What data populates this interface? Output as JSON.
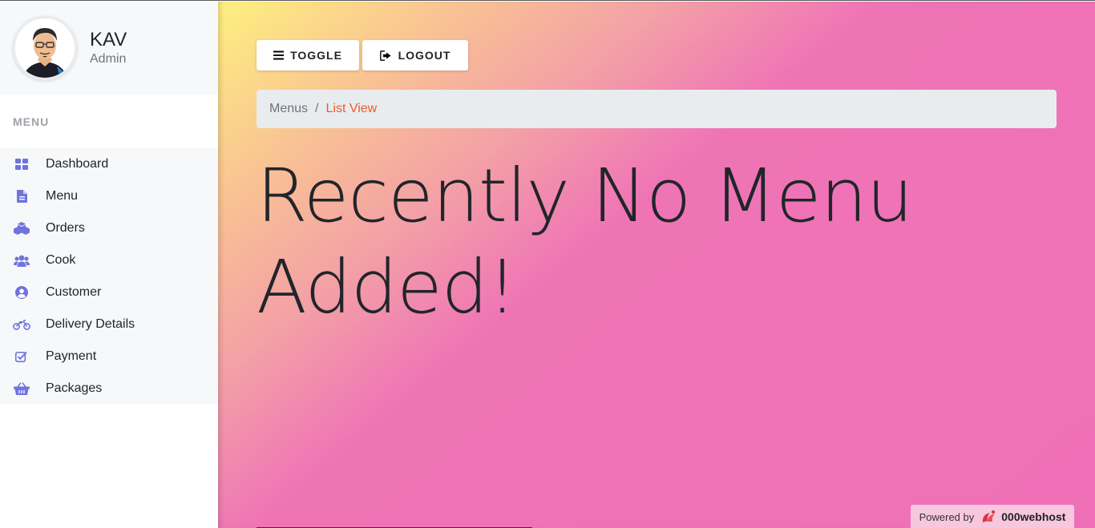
{
  "profile": {
    "name": "KAV",
    "role": "Admin"
  },
  "sidebar": {
    "heading": "MENU",
    "items": [
      {
        "label": "Dashboard",
        "icon": "dashboard-grid-icon"
      },
      {
        "label": "Menu",
        "icon": "document-icon"
      },
      {
        "label": "Orders",
        "icon": "cubes-icon"
      },
      {
        "label": "Cook",
        "icon": "users-icon"
      },
      {
        "label": "Customer",
        "icon": "user-circle-icon"
      },
      {
        "label": "Delivery Details",
        "icon": "motorcycle-icon"
      },
      {
        "label": "Payment",
        "icon": "check-square-icon"
      },
      {
        "label": "Packages",
        "icon": "basket-icon"
      }
    ],
    "icon_color": "#6f74dd"
  },
  "toolbar": {
    "toggle_label": "TOGGLE",
    "logout_label": "LOGOUT"
  },
  "breadcrumb": {
    "parent": "Menus",
    "separator": "/",
    "current": "List View"
  },
  "main": {
    "heading_line1": "Recently No Menu",
    "heading_line2": "Added!"
  },
  "footer": {
    "powered_by": "Powered by",
    "brand": "000webhost"
  },
  "colors": {
    "accent": "#f05a28",
    "gradient_start": "#fef07f",
    "gradient_end": "#ef70b6"
  }
}
